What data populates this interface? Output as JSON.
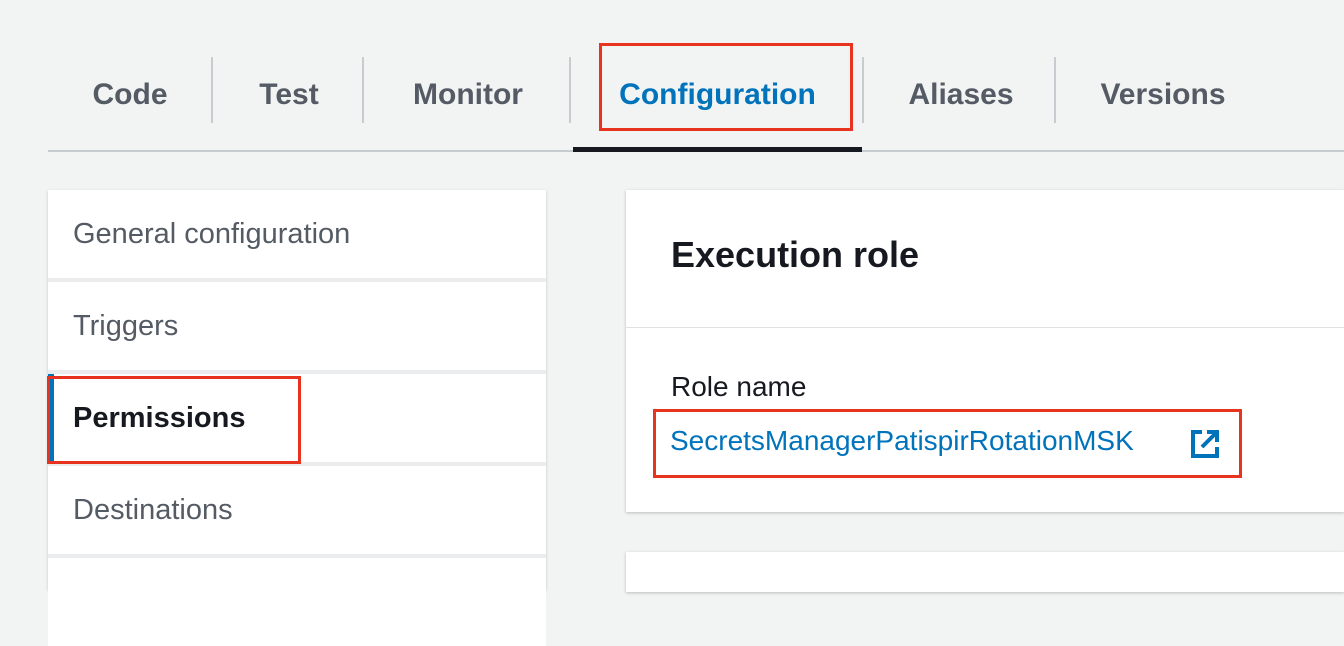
{
  "tabs": [
    {
      "label": "Code"
    },
    {
      "label": "Test"
    },
    {
      "label": "Monitor"
    },
    {
      "label": "Configuration",
      "active": true
    },
    {
      "label": "Aliases"
    },
    {
      "label": "Versions"
    }
  ],
  "sidebar": {
    "items": [
      {
        "label": "General configuration"
      },
      {
        "label": "Triggers"
      },
      {
        "label": "Permissions",
        "active": true
      },
      {
        "label": "Destinations"
      }
    ]
  },
  "execution_role": {
    "title": "Execution role",
    "role_name_label": "Role name",
    "role_name": "SecretsManagerPatispirRotationMSK",
    "link_icon": "external-link-icon"
  },
  "colors": {
    "accent_blue": "#0073bb",
    "highlight_red": "#e8331f",
    "background": "#f2f3f3"
  }
}
